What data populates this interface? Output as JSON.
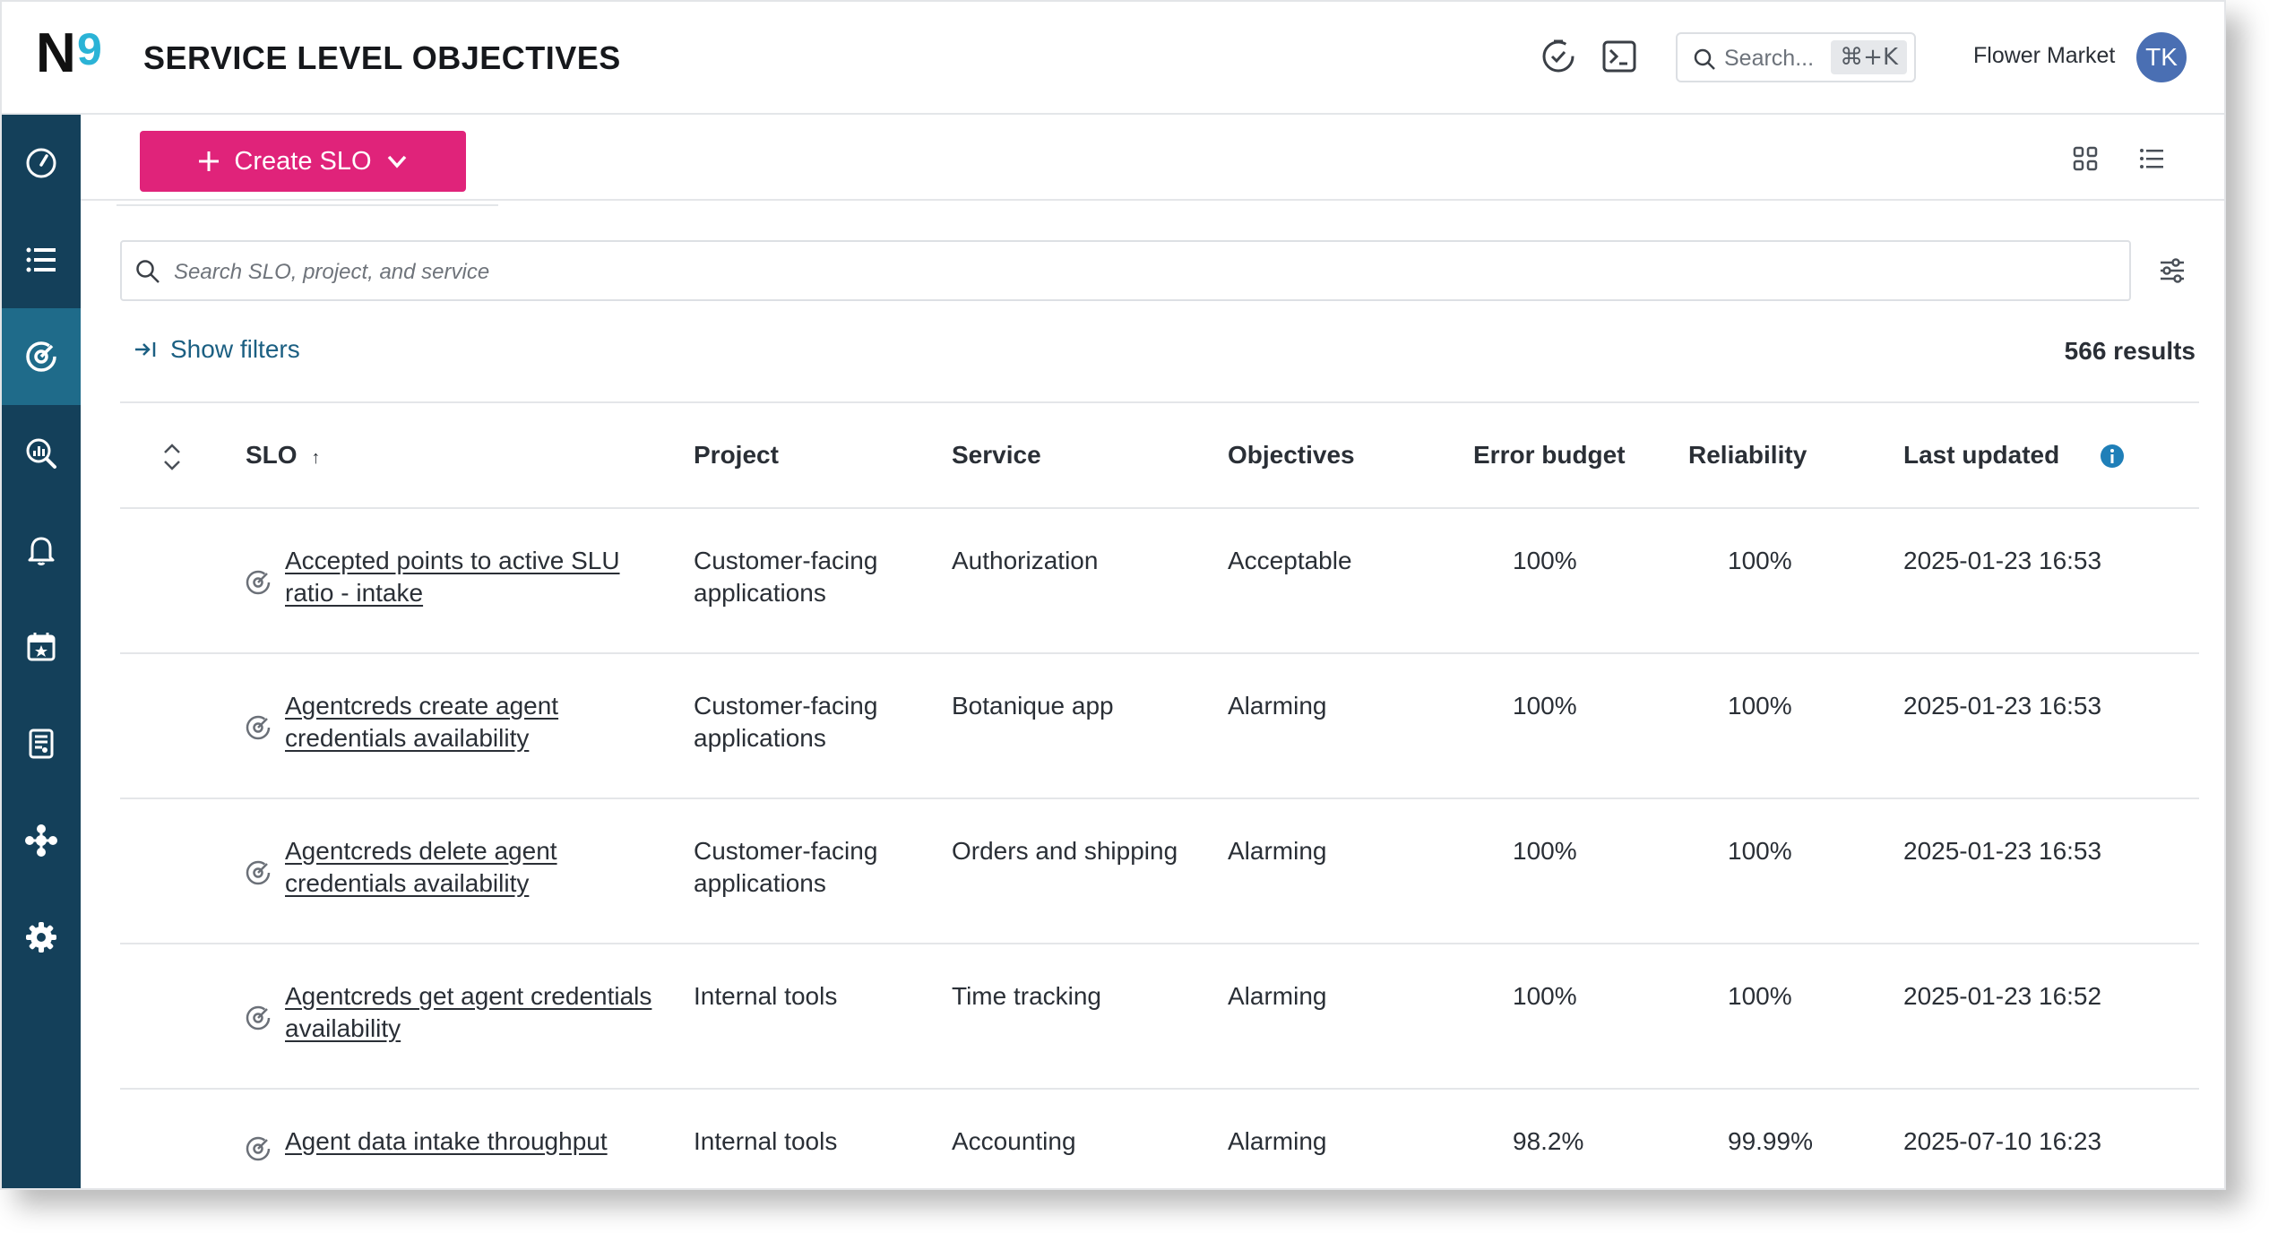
{
  "header": {
    "logo_text": "N9",
    "title": "SERVICE LEVEL OBJECTIVES",
    "search_placeholder": "Search...",
    "search_shortcut": "⌘+K",
    "org_name": "Flower Market",
    "avatar_initials": "TK"
  },
  "sidebar": {
    "items": [
      {
        "icon": "gauge-icon"
      },
      {
        "icon": "list-icon"
      },
      {
        "icon": "target-icon",
        "active": true
      },
      {
        "icon": "analytics-search-icon"
      },
      {
        "icon": "bell-icon"
      },
      {
        "icon": "calendar-star-icon"
      },
      {
        "icon": "report-icon"
      },
      {
        "icon": "integrations-icon"
      },
      {
        "icon": "settings-gear-icon"
      }
    ]
  },
  "toolbar": {
    "create_label": "Create SLO"
  },
  "search": {
    "placeholder": "Search SLO, project, and service"
  },
  "filters": {
    "show_label": "Show filters",
    "results_label": "566 results"
  },
  "table": {
    "columns": {
      "slo": "SLO",
      "slo_sort": "↑",
      "project": "Project",
      "service": "Service",
      "objectives": "Objectives",
      "error_budget": "Error budget",
      "reliability": "Reliability",
      "last_updated": "Last updated"
    },
    "rows": [
      {
        "name": "Accepted points to active SLU ratio - intake",
        "project": "Customer-facing applications",
        "service": "Authorization",
        "objectives": "Acceptable",
        "error_budget": "100%",
        "reliability": "100%",
        "last_updated": "2025-01-23 16:53"
      },
      {
        "name": "Agentcreds create agent credentials availability",
        "project": "Customer-facing applications",
        "service": "Botanique app",
        "objectives": "Alarming",
        "error_budget": "100%",
        "reliability": "100%",
        "last_updated": "2025-01-23 16:53"
      },
      {
        "name": "Agentcreds delete agent credentials availability",
        "project": "Customer-facing applications",
        "service": "Orders and shipping",
        "objectives": "Alarming",
        "error_budget": "100%",
        "reliability": "100%",
        "last_updated": "2025-01-23 16:53"
      },
      {
        "name": "Agentcreds get agent credentials availability",
        "project": "Internal tools",
        "service": "Time tracking",
        "objectives": "Alarming",
        "error_budget": "100%",
        "reliability": "100%",
        "last_updated": "2025-01-23 16:52"
      },
      {
        "name": "Agent data intake throughput",
        "project": "Internal tools",
        "service": "Accounting",
        "objectives": "Alarming",
        "error_budget": "98.2%",
        "reliability": "99.99%",
        "last_updated": "2025-07-10 16:23"
      }
    ]
  },
  "colors": {
    "sidebar_bg": "#14405a",
    "sidebar_active": "#1f6b8a",
    "primary_button": "#e0237a",
    "link_blue": "#1b5f82",
    "avatar_bg": "#4a6fb3"
  }
}
